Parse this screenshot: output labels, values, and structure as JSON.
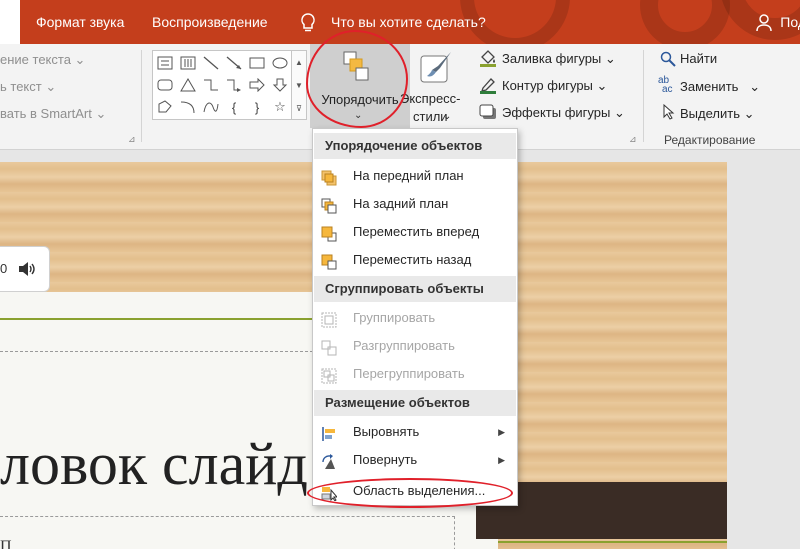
{
  "tabs": {
    "format_audio": "Формат звука",
    "playback": "Воспроизведение",
    "tell_me": "Что вы хотите сделать?",
    "share": "Под"
  },
  "ribbon": {
    "left": {
      "text_direction": "ение текста",
      "align_text": "ь текст",
      "smartart": "вать в SmartArt"
    },
    "arrange_label": "Упорядочить",
    "quick_styles_1": "Экспресс-",
    "quick_styles_2": "стили",
    "shape_fill": "Заливка фигуры",
    "shape_outline": "Контур фигуры",
    "shape_effects": "Эффекты фигуры",
    "find": "Найти",
    "replace": "Заменить",
    "select": "Выделить",
    "editing_group": "Редактирование"
  },
  "menu": {
    "order_header": "Упорядочение объектов",
    "bring_front": "На передний план",
    "send_back": "На задний план",
    "bring_forward": "Переместить вперед",
    "send_backward": "Переместить назад",
    "group_header": "Сгруппировать объекты",
    "group": "Группировать",
    "ungroup": "Разгруппировать",
    "regroup": "Перегруппировать",
    "position_header": "Размещение объектов",
    "align": "Выровнять",
    "rotate": "Повернуть",
    "selection_pane": "Область выделения..."
  },
  "slide": {
    "title": "ловок слайд",
    "subtitle": "П",
    "audio_time": "0"
  },
  "colors": {
    "accent": "#c43e1c",
    "annotation": "#e0202a"
  }
}
